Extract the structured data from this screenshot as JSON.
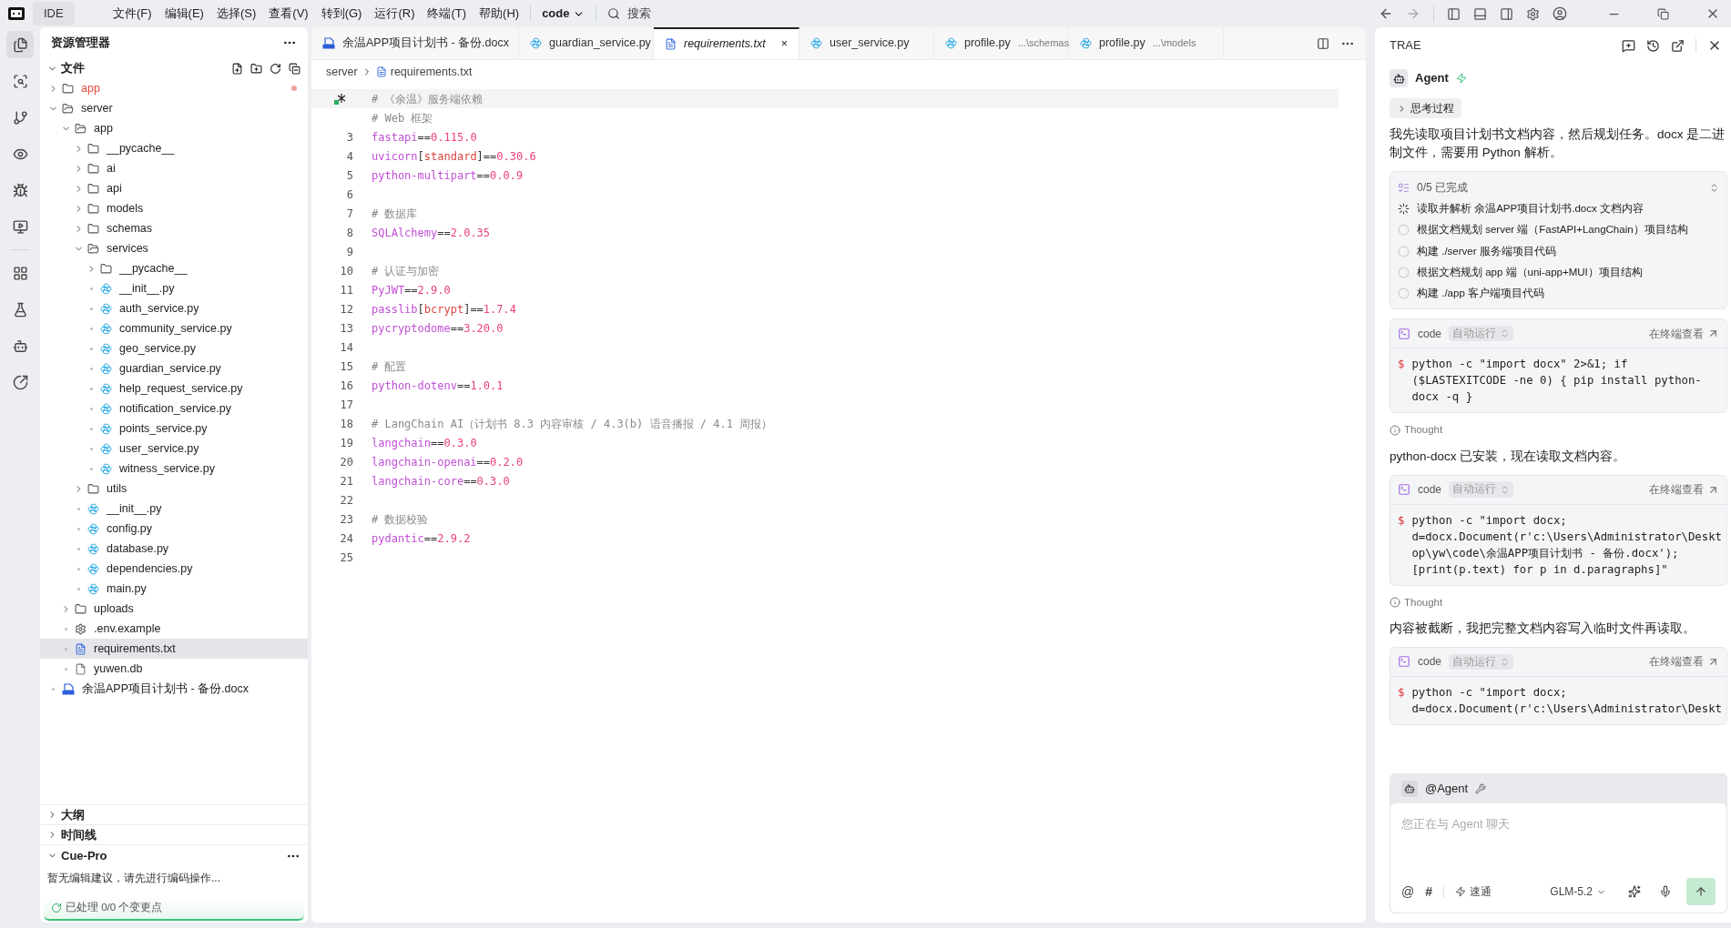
{
  "menu_bar": {
    "app_label": "IDE",
    "items": [
      "文件(F)",
      "编辑(E)",
      "选择(S)",
      "查看(V)",
      "转到(G)",
      "运行(R)",
      "终端(T)",
      "帮助(H)"
    ],
    "project": "code",
    "search": "搜索"
  },
  "activity_bar": [
    {
      "selected": true
    },
    {
      "selected": false
    },
    {
      "selected": false
    },
    {
      "selected": false
    },
    {
      "selected": false
    },
    {
      "selected": false
    },
    {
      "selected": false
    },
    {
      "selected": false
    },
    {
      "selected": false
    },
    {
      "selected": false
    }
  ],
  "explorer": {
    "title": "资源管理器",
    "section": "文件",
    "tree": [
      {
        "name": "app",
        "kind": "folder",
        "expanded": false,
        "modified": true,
        "selected": false
      },
      {
        "name": "server",
        "kind": "folder",
        "expanded": true,
        "modified": false,
        "selected": false,
        "children": [
          {
            "name": "app",
            "kind": "folder",
            "expanded": true,
            "modified": false,
            "selected": false,
            "children": [
              {
                "name": "__pycache__",
                "kind": "folder",
                "expanded": false,
                "modified": false,
                "selected": false
              },
              {
                "name": "ai",
                "kind": "folder",
                "expanded": false,
                "modified": false,
                "selected": false
              },
              {
                "name": "api",
                "kind": "folder",
                "expanded": false,
                "modified": false,
                "selected": false
              },
              {
                "name": "models",
                "kind": "folder",
                "expanded": false,
                "modified": false,
                "selected": false
              },
              {
                "name": "schemas",
                "kind": "folder",
                "expanded": false,
                "modified": false,
                "selected": false
              },
              {
                "name": "services",
                "kind": "folder",
                "expanded": true,
                "modified": false,
                "selected": false,
                "children": [
                  {
                    "name": "__pycache__",
                    "kind": "folder",
                    "expanded": false,
                    "modified": false,
                    "selected": false
                  },
                  {
                    "name": "__init__.py",
                    "kind": "python",
                    "modified": false,
                    "selected": false
                  },
                  {
                    "name": "auth_service.py",
                    "kind": "python",
                    "modified": false,
                    "selected": false
                  },
                  {
                    "name": "community_service.py",
                    "kind": "python",
                    "modified": false,
                    "selected": false
                  },
                  {
                    "name": "geo_service.py",
                    "kind": "python",
                    "modified": false,
                    "selected": false
                  },
                  {
                    "name": "guardian_service.py",
                    "kind": "python",
                    "modified": false,
                    "selected": false
                  },
                  {
                    "name": "help_request_service.py",
                    "kind": "python",
                    "modified": false,
                    "selected": false
                  },
                  {
                    "name": "notification_service.py",
                    "kind": "python",
                    "modified": false,
                    "selected": false
                  },
                  {
                    "name": "points_service.py",
                    "kind": "python",
                    "modified": false,
                    "selected": false
                  },
                  {
                    "name": "user_service.py",
                    "kind": "python",
                    "modified": false,
                    "selected": false
                  },
                  {
                    "name": "witness_service.py",
                    "kind": "python",
                    "modified": false,
                    "selected": false
                  }
                ]
              },
              {
                "name": "utils",
                "kind": "folder",
                "expanded": false,
                "modified": false,
                "selected": false
              },
              {
                "name": "__init__.py",
                "kind": "python",
                "modified": false,
                "selected": false
              },
              {
                "name": "config.py",
                "kind": "python",
                "modified": false,
                "selected": false
              },
              {
                "name": "database.py",
                "kind": "python",
                "modified": false,
                "selected": false
              },
              {
                "name": "dependencies.py",
                "kind": "python",
                "modified": false,
                "selected": false
              },
              {
                "name": "main.py",
                "kind": "python",
                "modified": false,
                "selected": false
              }
            ]
          },
          {
            "name": "uploads",
            "kind": "folder",
            "expanded": false,
            "modified": false,
            "selected": false
          },
          {
            "name": ".env.example",
            "kind": "gear",
            "modified": false,
            "selected": false
          },
          {
            "name": "requirements.txt",
            "kind": "text",
            "modified": false,
            "selected": true
          },
          {
            "name": "yuwen.db",
            "kind": "file",
            "modified": false,
            "selected": false
          }
        ]
      },
      {
        "name": "余温APP项目计划书 - 备份.docx",
        "kind": "docx",
        "modified": false,
        "selected": false
      }
    ],
    "panels": [
      {
        "title": "大纲",
        "expanded": false
      },
      {
        "title": "时间线",
        "expanded": false
      }
    ],
    "cue_pro": {
      "title": "Cue-Pro",
      "message": "暂无编辑建议，请先进行编码操作...",
      "status": "已处理 0/0 个变更点"
    }
  },
  "editor": {
    "tabs": [
      {
        "name": "余温APP项目计划书 - 备份.docx",
        "kind": "docx",
        "selected": false
      },
      {
        "name": "guardian_service.py",
        "kind": "python",
        "selected": false
      },
      {
        "name": "requirements.txt",
        "kind": "text",
        "selected": true,
        "close": "×"
      },
      {
        "name": "user_service.py",
        "kind": "python",
        "selected": false
      },
      {
        "name": "profile.py",
        "kind": "python",
        "selected": false,
        "hint": "...\\schemas"
      },
      {
        "name": "profile.py",
        "kind": "python",
        "selected": false,
        "hint": "...\\models"
      }
    ],
    "breadcrumb": [
      "server",
      "requirements.txt"
    ],
    "lines": [
      {
        "segments": [
          {
            "kind": "comment",
            "text": "# 《余温》服务端依赖"
          }
        ]
      },
      {
        "segments": [
          {
            "kind": "comment",
            "text": "# Web 框架"
          }
        ]
      },
      {
        "number": "3",
        "segments": [
          {
            "kind": "name",
            "text": "fastapi"
          },
          {
            "kind": "op",
            "text": "=="
          },
          {
            "kind": "version",
            "text": "0.115.0"
          }
        ]
      },
      {
        "number": "4",
        "segments": [
          {
            "kind": "name",
            "text": "uvicorn"
          },
          {
            "kind": "op",
            "text": "["
          },
          {
            "kind": "extra",
            "text": "standard"
          },
          {
            "kind": "op",
            "text": "]=="
          },
          {
            "kind": "version",
            "text": "0.30.6"
          }
        ]
      },
      {
        "number": "5",
        "segments": [
          {
            "kind": "name",
            "text": "python-multipart"
          },
          {
            "kind": "op",
            "text": "=="
          },
          {
            "kind": "version",
            "text": "0.0.9"
          }
        ]
      },
      {
        "number": "6"
      },
      {
        "number": "7",
        "segments": [
          {
            "kind": "comment",
            "text": "# 数据库"
          }
        ]
      },
      {
        "number": "8",
        "segments": [
          {
            "kind": "name",
            "text": "SQLAlchemy"
          },
          {
            "kind": "op",
            "text": "=="
          },
          {
            "kind": "version",
            "text": "2.0.35"
          }
        ]
      },
      {
        "number": "9"
      },
      {
        "number": "10",
        "segments": [
          {
            "kind": "comment",
            "text": "# 认证与加密"
          }
        ]
      },
      {
        "number": "11",
        "segments": [
          {
            "kind": "name",
            "text": "PyJWT"
          },
          {
            "kind": "op",
            "text": "=="
          },
          {
            "kind": "version",
            "text": "2.9.0"
          }
        ]
      },
      {
        "number": "12",
        "segments": [
          {
            "kind": "name",
            "text": "passlib"
          },
          {
            "kind": "op",
            "text": "["
          },
          {
            "kind": "extra",
            "text": "bcrypt"
          },
          {
            "kind": "op",
            "text": "]=="
          },
          {
            "kind": "version",
            "text": "1.7.4"
          }
        ]
      },
      {
        "number": "13",
        "segments": [
          {
            "kind": "name",
            "text": "pycryptodome"
          },
          {
            "kind": "op",
            "text": "=="
          },
          {
            "kind": "version",
            "text": "3.20.0"
          }
        ]
      },
      {
        "number": "14"
      },
      {
        "number": "15",
        "segments": [
          {
            "kind": "comment",
            "text": "# 配置"
          }
        ]
      },
      {
        "number": "16",
        "segments": [
          {
            "kind": "name",
            "text": "python-dotenv"
          },
          {
            "kind": "op",
            "text": "=="
          },
          {
            "kind": "version",
            "text": "1.0.1"
          }
        ]
      },
      {
        "number": "17"
      },
      {
        "number": "18",
        "segments": [
          {
            "kind": "comment",
            "text": "# LangChain AI（计划书 8.3 内容审核 / 4.3(b) 语音播报 / 4.1 周报）"
          }
        ]
      },
      {
        "number": "19",
        "segments": [
          {
            "kind": "name",
            "text": "langchain"
          },
          {
            "kind": "op",
            "text": "=="
          },
          {
            "kind": "version",
            "text": "0.3.0"
          }
        ]
      },
      {
        "number": "20",
        "segments": [
          {
            "kind": "name",
            "text": "langchain-openai"
          },
          {
            "kind": "op",
            "text": "=="
          },
          {
            "kind": "version",
            "text": "0.2.0"
          }
        ]
      },
      {
        "number": "21",
        "segments": [
          {
            "kind": "name",
            "text": "langchain-core"
          },
          {
            "kind": "op",
            "text": "=="
          },
          {
            "kind": "version",
            "text": "0.3.0"
          }
        ]
      },
      {
        "number": "22"
      },
      {
        "number": "23",
        "segments": [
          {
            "kind": "comment",
            "text": "# 数据校验"
          }
        ]
      },
      {
        "number": "24",
        "segments": [
          {
            "kind": "name",
            "text": "pydantic"
          },
          {
            "kind": "op",
            "text": "=="
          },
          {
            "kind": "version",
            "text": "2.9.2"
          }
        ]
      },
      {
        "number": "25"
      }
    ]
  },
  "assistant": {
    "title": "TRAE",
    "agent": "Agent",
    "thinking": "思考过程",
    "messages": [
      {
        "kind": "text",
        "text": "我先读取项目计划书文档内容，然后规划任务。docx 是二进制文件，需要用 Python 解析。"
      },
      {
        "kind": "todo",
        "title": "0/5 已完成",
        "items": [
          {
            "text": "读取并解析 余温APP项目计划书.docx 文档内容",
            "in_progress": true
          },
          {
            "text": "根据文档规划 server 端（FastAPI+LangChain）项目结构",
            "in_progress": false
          },
          {
            "text": "构建 ./server 服务端项目代码",
            "in_progress": false
          },
          {
            "text": "根据文档规划 app 端（uni-app+MUI）项目结构",
            "in_progress": false
          },
          {
            "text": "构建 ./app 客户端项目代码",
            "in_progress": false
          }
        ]
      },
      {
        "kind": "code",
        "label": "code",
        "mode": "自动运行",
        "link": "在终端查看",
        "prompt": "$",
        "lines": [
          "python -c \"import docx\" 2>&1; if",
          "($LASTEXITCODE -ne 0) { pip install python-",
          "docx -q }"
        ]
      },
      {
        "kind": "thought",
        "text": "Thought"
      },
      {
        "kind": "text",
        "text": "python-docx 已安装，现在读取文档内容。"
      },
      {
        "kind": "code",
        "label": "code",
        "mode": "自动运行",
        "link": "在终端查看",
        "prompt": "$",
        "lines": [
          "python -c \"import docx;",
          "d=docx.Document(r'c:\\Users\\Administrator\\Deskt",
          "op\\yw\\code\\余温APP项目计划书 - 备份.docx');",
          "[print(p.text) for p in d.paragraphs]\""
        ]
      },
      {
        "kind": "thought",
        "text": "Thought"
      },
      {
        "kind": "text",
        "text": "内容被截断，我把完整文档内容写入临时文件再读取。"
      },
      {
        "kind": "code",
        "label": "code",
        "mode": "自动运行",
        "link": "在终端查看",
        "prompt": "$",
        "lines": [
          "python -c \"import docx;",
          "d=docx.Document(r'c:\\Users\\Administrator\\Deskt"
        ]
      }
    ],
    "composer": {
      "mention": "@Agent",
      "placeholder": "您正在与 Agent 聊天",
      "at": "@",
      "hash": "#",
      "speed": "速通",
      "model": "GLM-5.2"
    }
  }
}
